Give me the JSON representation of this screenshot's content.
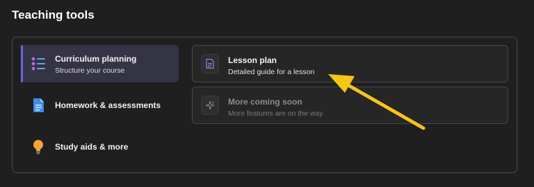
{
  "page": {
    "title": "Teaching tools"
  },
  "nav": {
    "items": [
      {
        "label": "Curriculum planning",
        "sublabel": "Structure your course",
        "icon": "list-icon",
        "active": true
      },
      {
        "label": "Homework & assessments",
        "icon": "document-icon",
        "active": false
      },
      {
        "label": "Study aids & more",
        "icon": "lightbulb-icon",
        "active": false
      }
    ]
  },
  "cards": [
    {
      "title": "Lesson plan",
      "subtitle": "Detailed guide for a lesson",
      "icon": "page-icon",
      "enabled": true
    },
    {
      "title": "More coming soon",
      "subtitle": "More features are on the way",
      "icon": "sparkle-icon",
      "enabled": false
    }
  ],
  "colors": {
    "accent": "#6f66e6",
    "arrow": "#f5c518",
    "background": "#1f1f1f"
  }
}
